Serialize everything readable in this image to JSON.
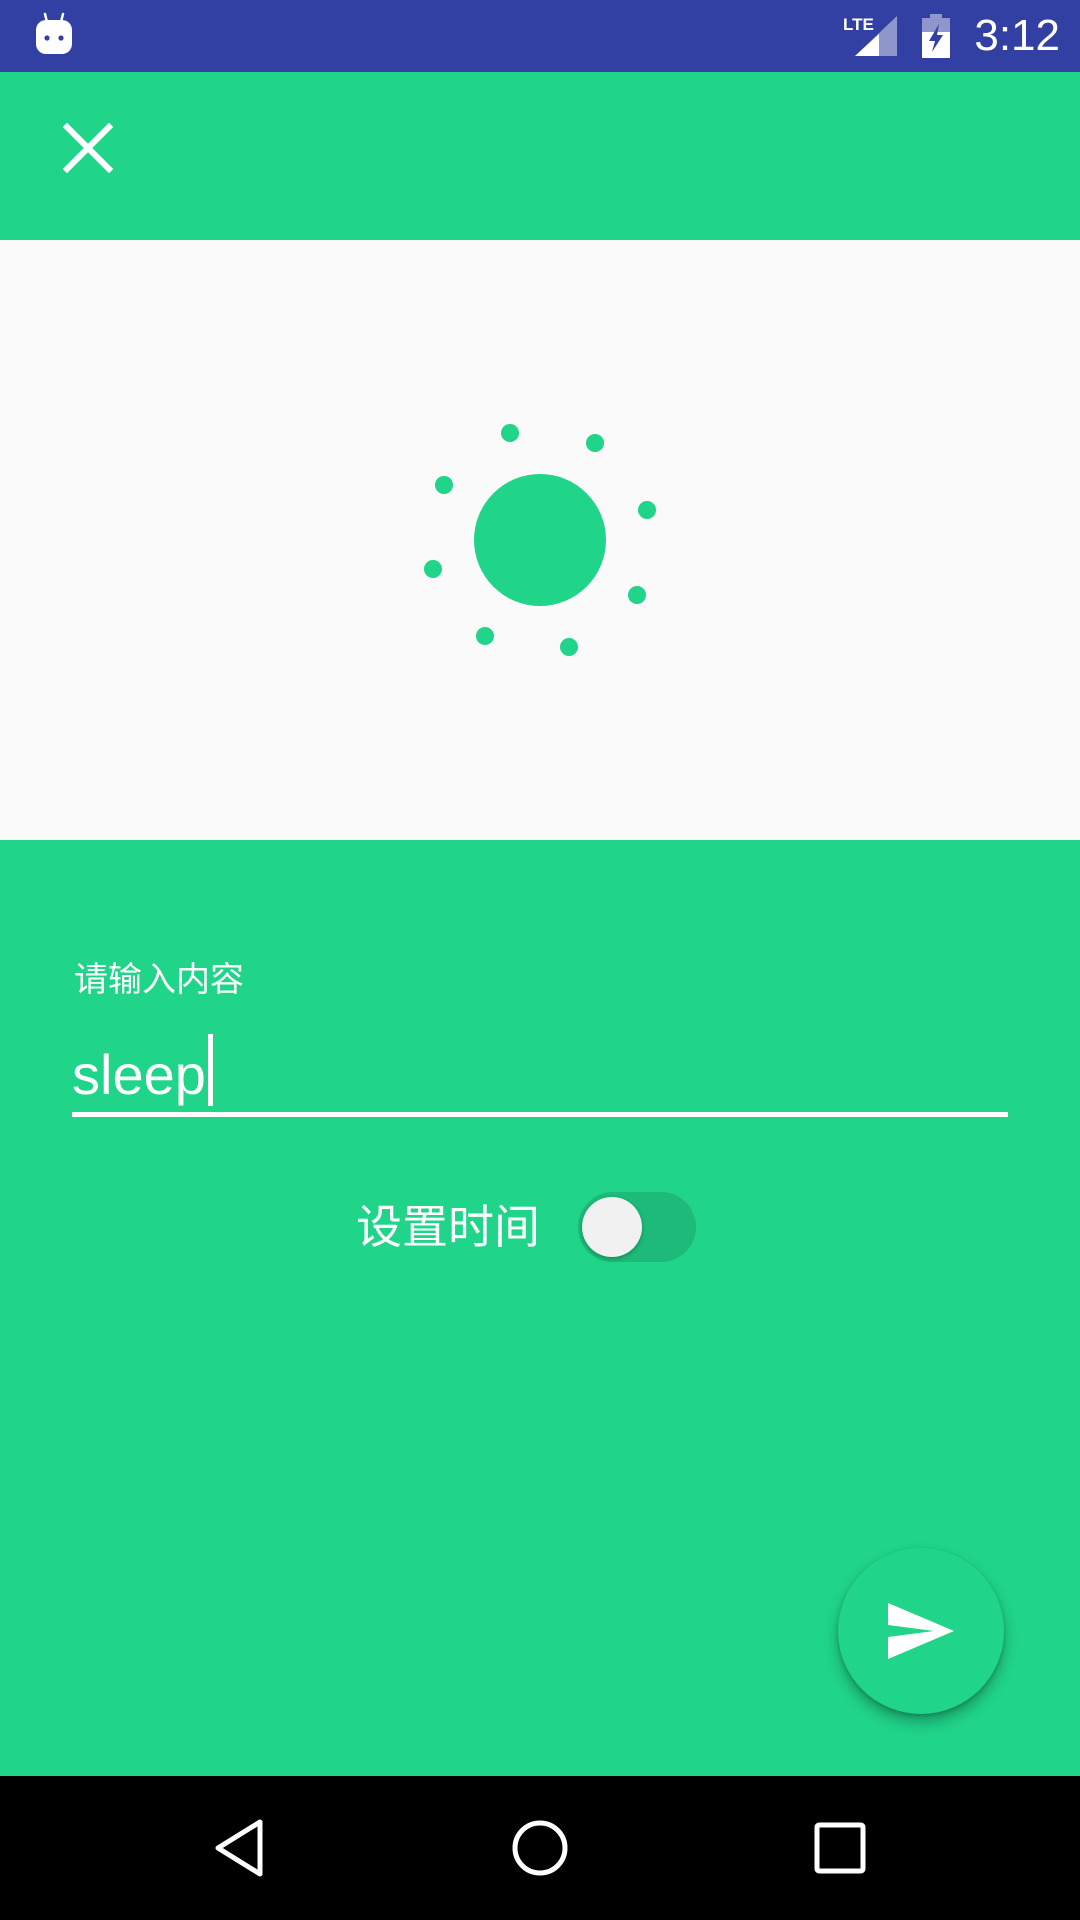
{
  "status_bar": {
    "time": "3:12",
    "network": "LTE",
    "icons": [
      "android-icon",
      "lte-signal-icon",
      "battery-charging-icon"
    ]
  },
  "toolbar": {
    "close_icon": "close-icon"
  },
  "illustration": {
    "icon": "sun-icon",
    "color": "#20d489"
  },
  "form": {
    "input_label": "请输入内容",
    "input_value": "sleep",
    "time_label": "设置时间",
    "time_switch_on": false
  },
  "fab": {
    "icon": "send-icon"
  },
  "nav_bar": {
    "icons": [
      "back-icon",
      "home-icon",
      "recents-icon"
    ]
  },
  "colors": {
    "primary": "#20d489",
    "status_bar": "#3340a3",
    "illustration_bg": "#fafafa",
    "switch_track": "#1dba79",
    "nav_bar": "#000000"
  }
}
